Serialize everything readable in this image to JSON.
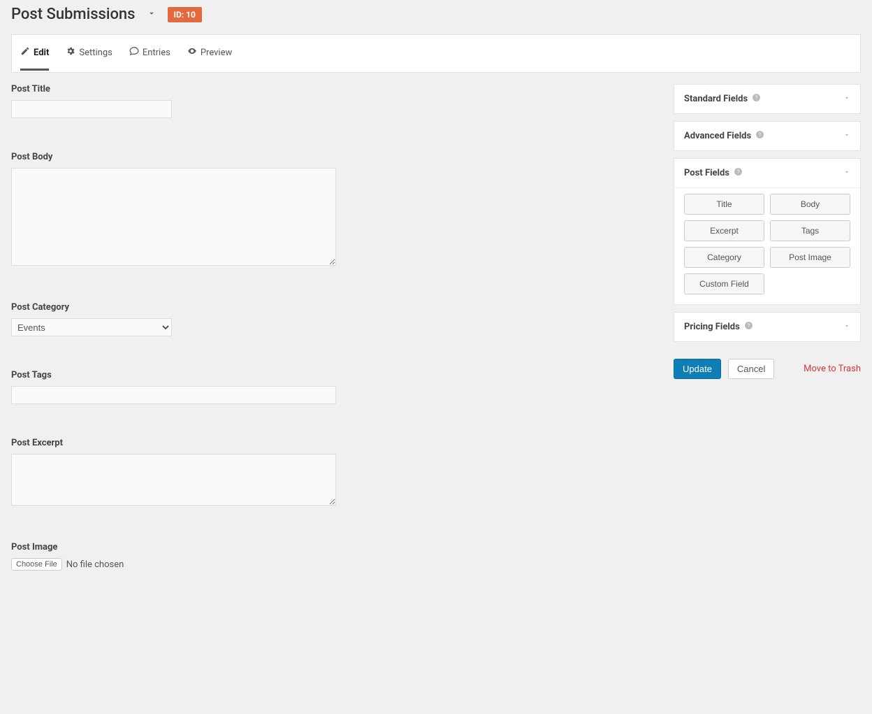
{
  "header": {
    "title": "Post Submissions",
    "id_badge": "ID: 10"
  },
  "tabs": {
    "edit": "Edit",
    "settings": "Settings",
    "entries": "Entries",
    "preview": "Preview"
  },
  "fields": {
    "post_title": {
      "label": "Post Title",
      "value": ""
    },
    "post_body": {
      "label": "Post Body",
      "value": ""
    },
    "post_category": {
      "label": "Post Category",
      "selected": "Events"
    },
    "post_tags": {
      "label": "Post Tags",
      "value": ""
    },
    "post_excerpt": {
      "label": "Post Excerpt",
      "value": ""
    },
    "post_image": {
      "label": "Post Image",
      "button": "Choose File",
      "status": "No file chosen"
    }
  },
  "sidebar": {
    "standard": {
      "title": "Standard Fields"
    },
    "advanced": {
      "title": "Advanced Fields"
    },
    "post": {
      "title": "Post Fields",
      "items": {
        "title": "Title",
        "body": "Body",
        "excerpt": "Excerpt",
        "tags": "Tags",
        "category": "Category",
        "post_image": "Post Image",
        "custom_field": "Custom Field"
      }
    },
    "pricing": {
      "title": "Pricing Fields"
    }
  },
  "actions": {
    "update": "Update",
    "cancel": "Cancel",
    "trash": "Move to Trash"
  }
}
